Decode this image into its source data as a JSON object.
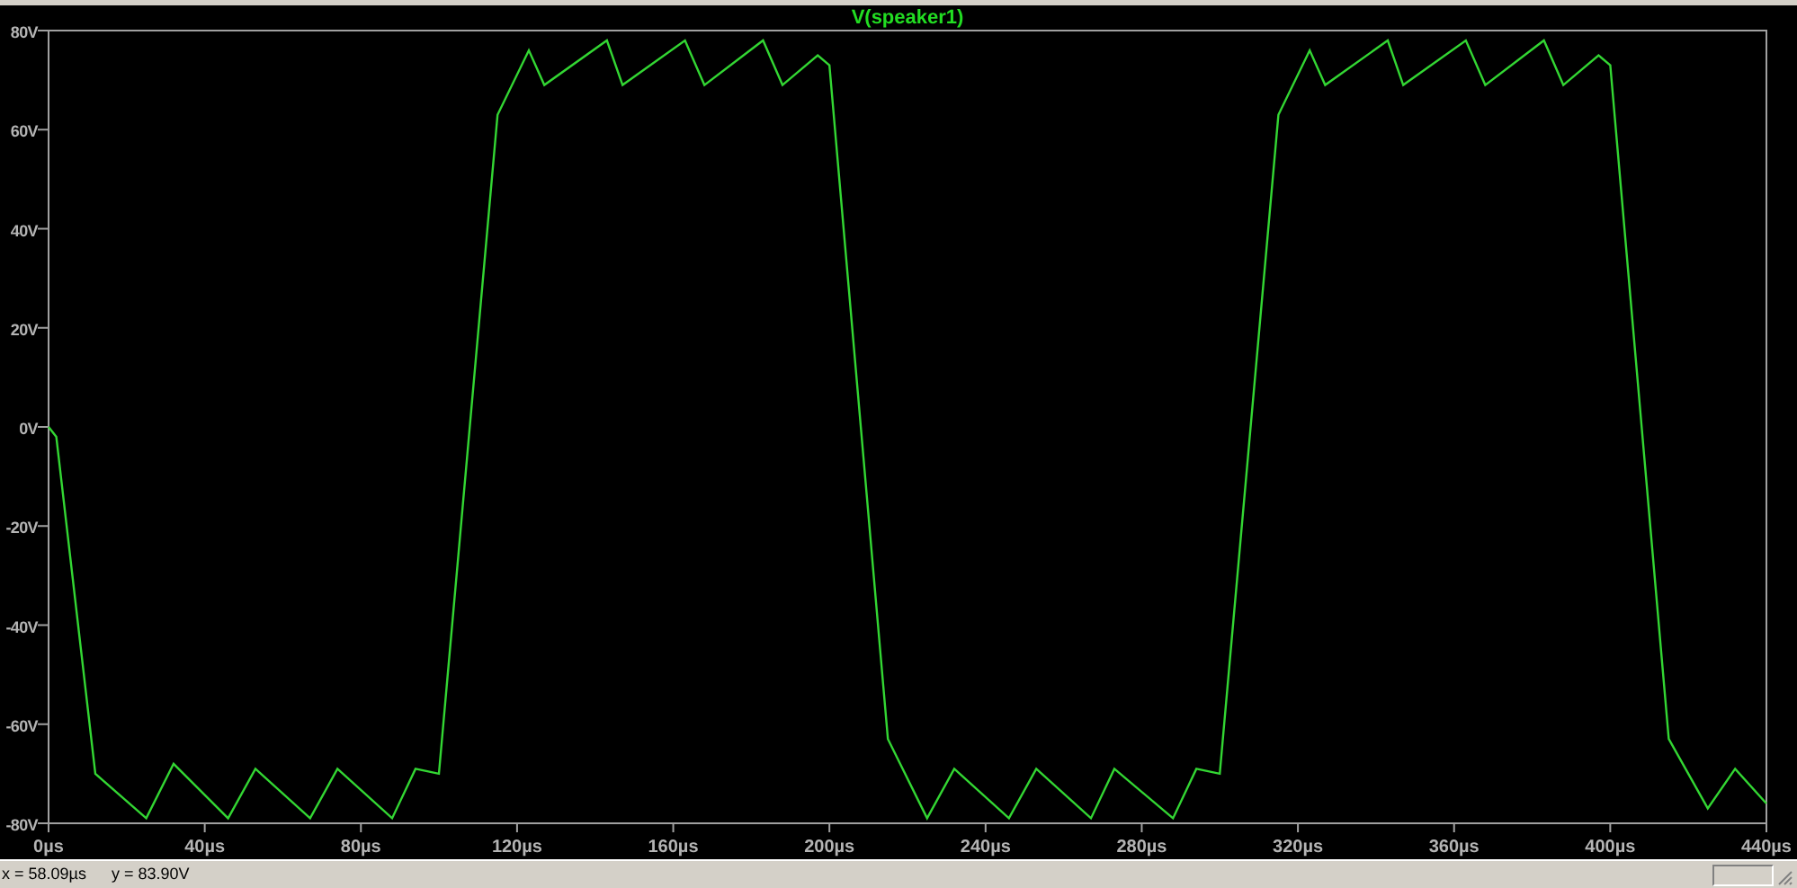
{
  "plot": {
    "chart_data": {
      "type": "line",
      "x": [
        0,
        2,
        12,
        25,
        32,
        46,
        53,
        67,
        74,
        88,
        94,
        100,
        115,
        123,
        127,
        143,
        147,
        163,
        168,
        183,
        188,
        197,
        200,
        215,
        225,
        232,
        246,
        253,
        267,
        273,
        288,
        294,
        300,
        315,
        323,
        327,
        343,
        347,
        363,
        368,
        383,
        388,
        397,
        400,
        415,
        425,
        432,
        440
      ],
      "series": [
        {
          "name": "V(speaker1)",
          "color": "#33d633",
          "values": [
            0,
            -2,
            -70,
            -79,
            -68,
            -79,
            -69,
            -79,
            -69,
            -79,
            -69,
            -70,
            63,
            76,
            69,
            78,
            69,
            78,
            69,
            78,
            69,
            75,
            73,
            -63,
            -79,
            -69,
            -79,
            -69,
            -79,
            -69,
            -79,
            -69,
            -70,
            63,
            76,
            69,
            78,
            69,
            78,
            69,
            78,
            69,
            75,
            73,
            -63,
            -77,
            -69,
            -76
          ]
        }
      ],
      "xlim": [
        0,
        440
      ],
      "ylim": [
        -80,
        80
      ],
      "xticks": [
        {
          "value": 0,
          "label": "0µs"
        },
        {
          "value": 40,
          "label": "40µs"
        },
        {
          "value": 80,
          "label": "80µs"
        },
        {
          "value": 120,
          "label": "120µs"
        },
        {
          "value": 160,
          "label": "160µs"
        },
        {
          "value": 200,
          "label": "200µs"
        },
        {
          "value": 240,
          "label": "240µs"
        },
        {
          "value": 280,
          "label": "280µs"
        },
        {
          "value": 320,
          "label": "320µs"
        },
        {
          "value": 360,
          "label": "360µs"
        },
        {
          "value": 400,
          "label": "400µs"
        },
        {
          "value": 440,
          "label": "440µs"
        }
      ],
      "yticks": [
        {
          "value": 80,
          "label": "80V"
        },
        {
          "value": 60,
          "label": "60V"
        },
        {
          "value": 40,
          "label": "40V"
        },
        {
          "value": 20,
          "label": "20V"
        },
        {
          "value": 0,
          "label": "0V"
        },
        {
          "value": -20,
          "label": "-20V"
        },
        {
          "value": -40,
          "label": "-40V"
        },
        {
          "value": -60,
          "label": "-60V"
        },
        {
          "value": -80,
          "label": "-80V"
        }
      ]
    }
  },
  "status_bar": {
    "cursor_x": "x = 58.09µs",
    "cursor_y": "y = 83.90V"
  }
}
